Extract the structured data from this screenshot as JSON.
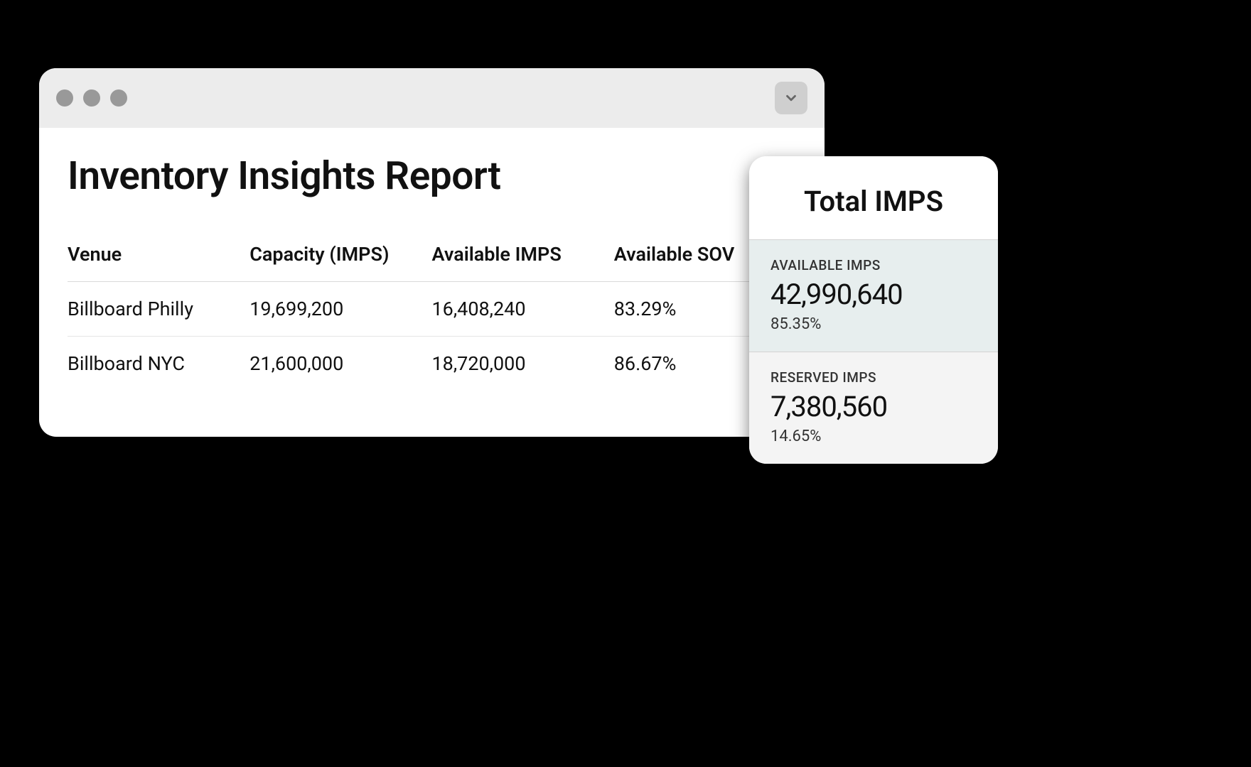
{
  "report": {
    "title": "Inventory Insights Report",
    "columns": [
      "Venue",
      "Capacity (IMPS)",
      "Available IMPS",
      "Available SOV"
    ],
    "rows": [
      {
        "venue": "Billboard Philly",
        "capacity": "19,699,200",
        "available": "16,408,240",
        "sov": "83.29%"
      },
      {
        "venue": "Billboard NYC",
        "capacity": "21,600,000",
        "available": "18,720,000",
        "sov": "86.67%"
      }
    ]
  },
  "summary": {
    "title": "Total IMPS",
    "available": {
      "label": "AVAILABLE IMPS",
      "value": "42,990,640",
      "pct": "85.35%"
    },
    "reserved": {
      "label": "RESERVED IMPS",
      "value": "7,380,560",
      "pct": "14.65%"
    }
  }
}
